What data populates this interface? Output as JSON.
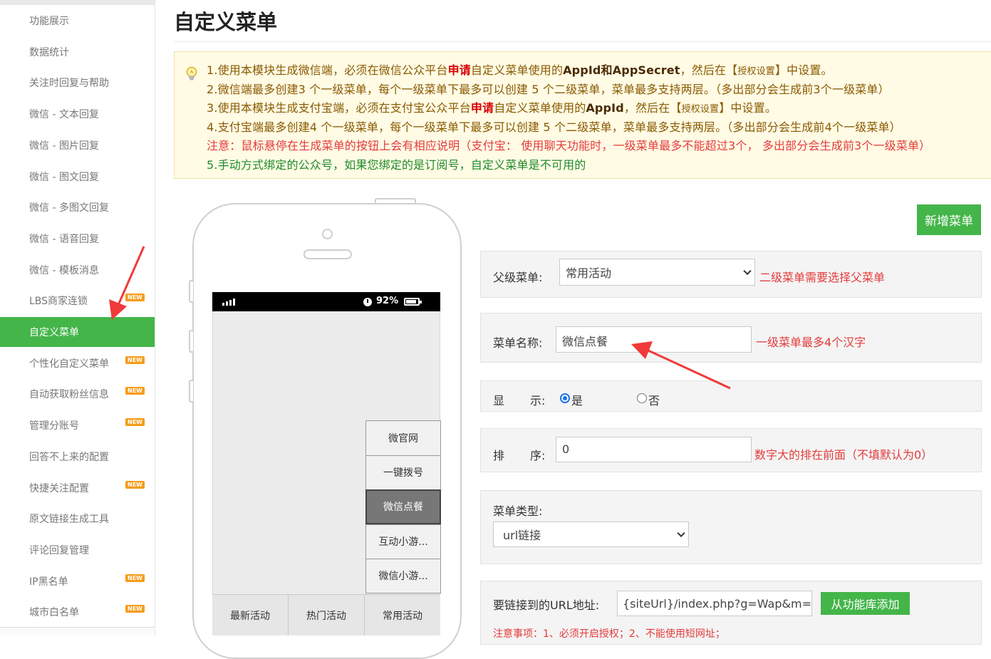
{
  "sidebar": {
    "items": [
      {
        "label": "功能展示",
        "new": false
      },
      {
        "label": "数据统计",
        "new": false
      },
      {
        "label": "关注时回复与帮助",
        "new": false
      },
      {
        "label": "微信 - 文本回复",
        "new": false
      },
      {
        "label": "微信 - 图片回复",
        "new": false
      },
      {
        "label": "微信 - 图文回复",
        "new": false
      },
      {
        "label": "微信 - 多图文回复",
        "new": false
      },
      {
        "label": "微信 - 语音回复",
        "new": false
      },
      {
        "label": "微信 - 模板消息",
        "new": false
      },
      {
        "label": "LBS商家连锁",
        "new": true
      },
      {
        "label": "自定义菜单",
        "new": false,
        "active": true
      },
      {
        "label": "个性化自定义菜单",
        "new": true
      },
      {
        "label": "自动获取粉丝信息",
        "new": true
      },
      {
        "label": "管理分账号",
        "new": true
      },
      {
        "label": "回答不上来的配置",
        "new": false
      },
      {
        "label": "快捷关注配置",
        "new": true
      },
      {
        "label": "原文链接生成工具",
        "new": false
      },
      {
        "label": "评论回复管理",
        "new": false
      },
      {
        "label": "IP黑名单",
        "new": true
      },
      {
        "label": "城市白名单",
        "new": true
      }
    ],
    "new_badge": "NEW"
  },
  "page_title": "自定义菜单",
  "notice": {
    "l1_a": "1.使用本模块生成微信端，必须在微信公众平台",
    "l1_b": "申请",
    "l1_c": "自定义菜单使用的",
    "l1_d": "AppId和AppSecret",
    "l1_e": "，然后在【",
    "l1_f": "授权设置",
    "l1_g": "】中设置。",
    "l2": "2.微信端最多创建3 个一级菜单，每个一级菜单下最多可以创建 5 个二级菜单，菜单最多支持两层。（多出部分会生成前3个一级菜单）",
    "l3_a": "3.使用本模块生成支付宝端，必须在支付宝公众平台",
    "l3_b": "申请",
    "l3_c": "自定义菜单使用的",
    "l3_d": "AppId",
    "l3_e": "，然后在【",
    "l3_f": "授权设置",
    "l3_g": "】中设置。",
    "l4": "4.支付宝端最多创建4 个一级菜单，每个一级菜单下最多可以创建 5 个二级菜单，菜单最多支持两层。（多出部分会生成前4个一级菜单）",
    "l5": "注意：鼠标悬停在生成菜单的按钮上会有相应说明（支付宝： 使用聊天功能时，一级菜单最多不能超过3个， 多出部分会生成前3个一级菜单）",
    "l6": "5.手动方式绑定的公众号，如果您绑定的是订阅号，自定义菜单是不可用的"
  },
  "phone": {
    "battery": "92%",
    "submenu": [
      "微官网",
      "一键拨号",
      "微信点餐",
      "互动小游...",
      "微信小游..."
    ],
    "selected_submenu": 2,
    "bottom_menu": [
      "最新活动",
      "热门活动",
      "常用活动"
    ]
  },
  "form": {
    "add_menu_label": "新增菜单",
    "parent_label": "父级菜单:",
    "parent_value": "常用活动",
    "parent_hint": "二级菜单需要选择父菜单",
    "name_label": "菜单名称:",
    "name_value": "微信点餐",
    "name_hint": "一级菜单最多4个汉字",
    "show_label_a": "显",
    "show_label_b": "示:",
    "show_yes": "是",
    "show_no": "否",
    "sort_label_a": "排",
    "sort_label_b": "序:",
    "sort_value": "0",
    "sort_hint": "数字大的排在前面（不填默认为0）",
    "type_label": "菜单类型:",
    "type_value": "url链接",
    "url_label": "要链接到的URL地址:",
    "url_value": "{siteUrl}/index.php?g=Wap&m=In",
    "url_button": "从功能库添加",
    "tips": "注意事项：1、必须开启授权；2、不能使用短网址；"
  },
  "colors": {
    "accent": "#44b549",
    "warning": "#e43b3b",
    "annotation": "#f03a3a"
  }
}
